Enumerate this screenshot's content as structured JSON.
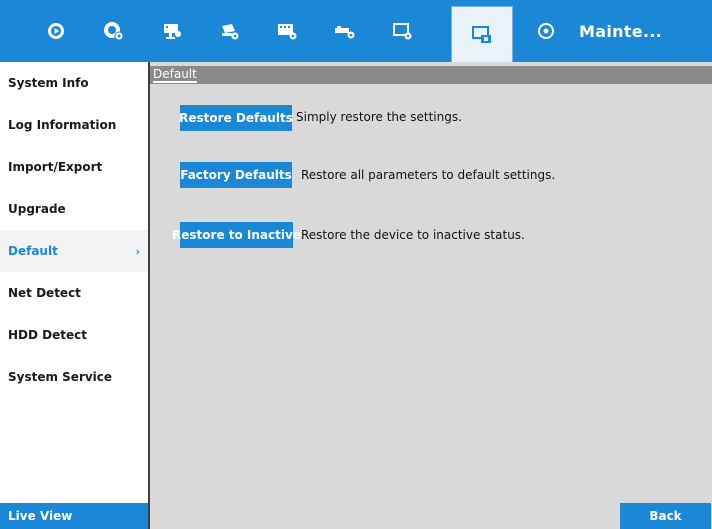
{
  "topbar": {
    "tabs": [
      {
        "icon": "playback-icon"
      },
      {
        "icon": "camera-settings-icon"
      },
      {
        "icon": "camera-icon"
      },
      {
        "icon": "recording-icon"
      },
      {
        "icon": "video-settings-icon"
      },
      {
        "icon": "network-icon"
      },
      {
        "icon": "display-icon"
      },
      {
        "icon": "system-maintenance-icon"
      },
      {
        "icon": "maintenance-icon"
      }
    ],
    "active_label": "Mainte..."
  },
  "sidebar": {
    "items": [
      {
        "label": "System Info"
      },
      {
        "label": "Log Information"
      },
      {
        "label": "Import/Export"
      },
      {
        "label": "Upgrade"
      },
      {
        "label": "Default",
        "chevron": "›"
      },
      {
        "label": "Net Detect"
      },
      {
        "label": "HDD Detect"
      },
      {
        "label": "System Service"
      }
    ],
    "live_view_label": "Live View"
  },
  "main": {
    "section_title": "Default",
    "actions": [
      {
        "button": "Restore Defaults",
        "description": "Simply restore the settings."
      },
      {
        "button": "Factory Defaults",
        "description": "Restore all parameters to default settings."
      },
      {
        "button": "Restore to Inactive",
        "description": "Restore the device to inactive status."
      }
    ],
    "back_label": "Back"
  },
  "colors": {
    "accent": "#1a88d6",
    "panel": "#d9d9d9",
    "header": "#8a8a8a"
  }
}
